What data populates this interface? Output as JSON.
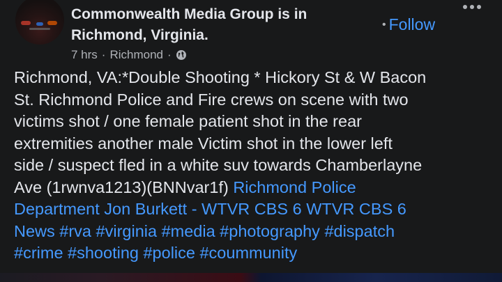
{
  "header": {
    "page_name": "Commonwealth Media Group",
    "location_line_1": " is in",
    "location_line_2": "Richmond, Virginia.",
    "time": "7 hrs",
    "place": "Richmond",
    "sep": "·",
    "privacy_icon": "globe-icon",
    "follow_label": "Follow"
  },
  "post": {
    "lines": [
      [
        {
          "t": "Richmond, VA:*Double Shooting * Hickory St & W Bacon"
        }
      ],
      [
        {
          "t": "St. Richmond Police and Fire crews on scene with two"
        }
      ],
      [
        {
          "t": "victims shot / one female patient shot in the rear"
        }
      ],
      [
        {
          "t": "extremities another male Victim shot in the lower left"
        }
      ],
      [
        {
          "t": "side / suspect fled in a white suv towards Chamberlayne"
        }
      ],
      [
        {
          "t": "Ave (1rwnva1213)(BNNvar1f) "
        },
        {
          "t": "Richmond Police",
          "link": true
        }
      ],
      [
        {
          "t": "Department Jon Burkett - WTVR CBS 6 WTVR CBS 6",
          "link": true
        }
      ],
      [
        {
          "t": "News #rva #virginia #media #photography #dispatch",
          "link": true
        }
      ],
      [
        {
          "t": "#crime #shooting #police #coummunity",
          "link": true
        }
      ]
    ]
  },
  "colors": {
    "background": "#18191a",
    "text": "#e4e6eb",
    "secondary": "#b0b3b8",
    "link": "#4599ff"
  }
}
